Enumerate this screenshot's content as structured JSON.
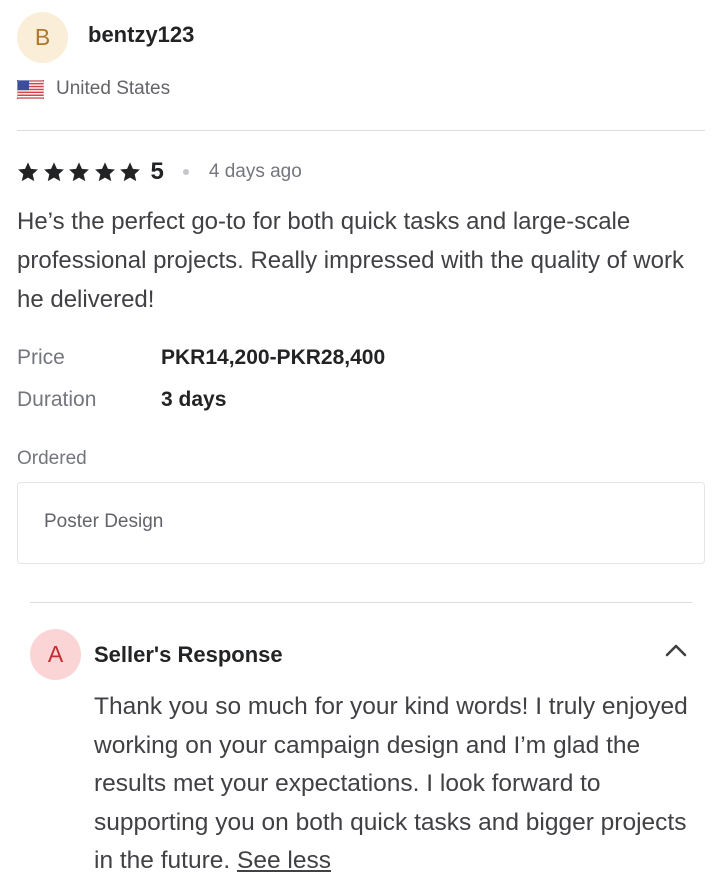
{
  "reviewer": {
    "avatar_initial": "B",
    "username": "bentzy123",
    "country": "United States",
    "flag_icon": "us-flag-icon"
  },
  "review": {
    "stars": 5,
    "rating": "5",
    "time_ago": "4 days ago",
    "text": "He’s the perfect go-to for both quick tasks and large-scale professional projects. Really impressed with the quality of work he delivered!"
  },
  "details": {
    "price_label": "Price",
    "price_value": "PKR14,200-PKR28,400",
    "duration_label": "Duration",
    "duration_value": "3 days",
    "ordered_label": "Ordered",
    "ordered_item": "Poster Design"
  },
  "seller_response": {
    "avatar_initial": "A",
    "title": "Seller's Response",
    "text": "Thank you so much for your kind words! I truly enjoyed working on your campaign design and I’m glad the results met your expectations. I look forward to supporting you on both quick tasks and bigger projects in the future.",
    "see_less_label": "See less"
  },
  "colors": {
    "reviewer_avatar_bg": "#fbeed9",
    "reviewer_avatar_text": "#b0762b",
    "seller_avatar_bg": "#fbd5d5",
    "seller_avatar_text": "#c42c33",
    "star": "#222325"
  }
}
